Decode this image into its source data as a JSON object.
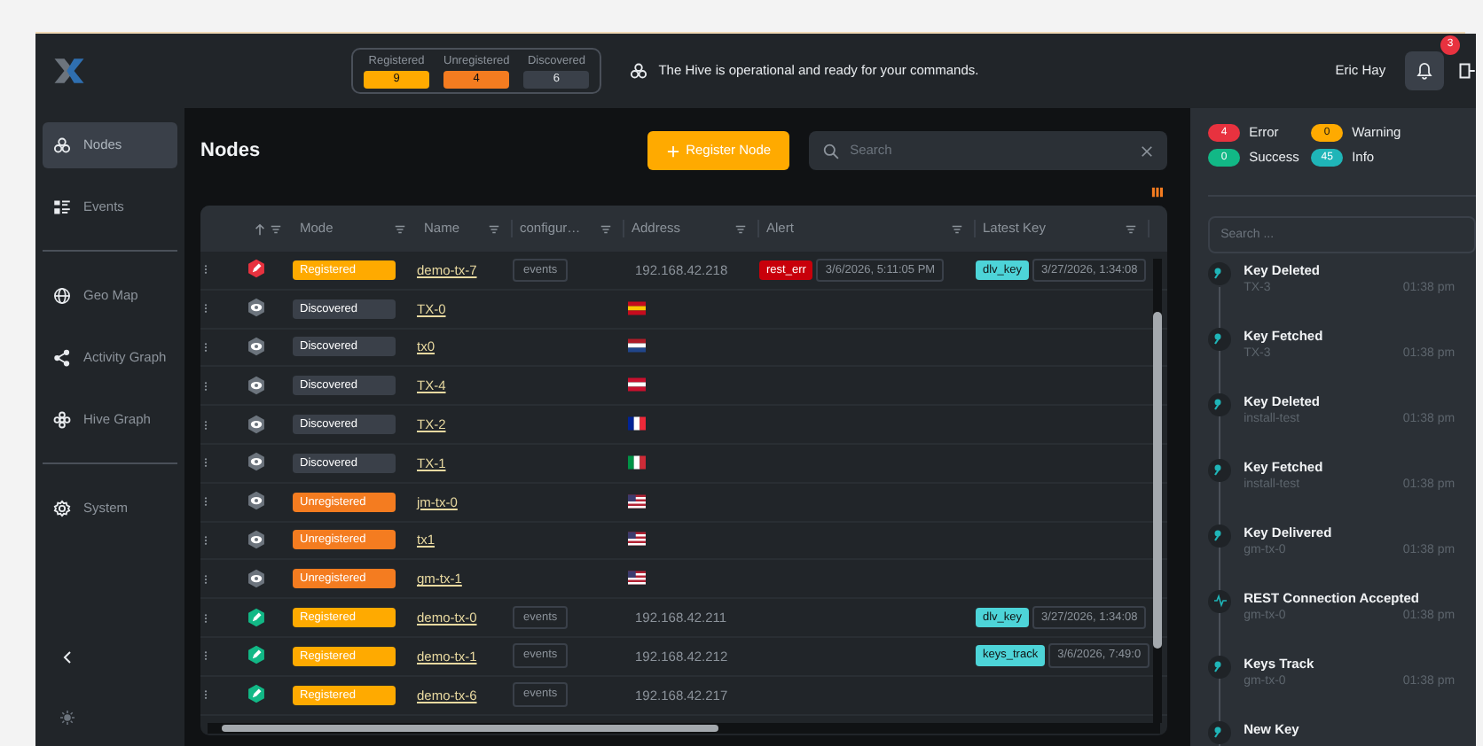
{
  "header": {
    "counters": [
      {
        "label": "Registered",
        "value": "9",
        "color": "#ffaa00"
      },
      {
        "label": "Unregistered",
        "value": "4",
        "color": "#f47c20"
      },
      {
        "label": "Discovered",
        "value": "6",
        "color": "#3a4049"
      }
    ],
    "status_message": "The Hive is operational and ready for your commands.",
    "user": "Eric Hay",
    "notification_count": "3"
  },
  "sidebar": {
    "sections": [
      [
        {
          "label": "Nodes",
          "kind": "hive",
          "selected": true
        },
        {
          "label": "Events",
          "kind": "list",
          "selected": false
        }
      ],
      [
        {
          "label": "Geo Map",
          "kind": "globe",
          "selected": false
        },
        {
          "label": "Activity Graph",
          "kind": "share",
          "selected": false
        },
        {
          "label": "Hive Graph",
          "kind": "flower",
          "selected": false
        }
      ],
      [
        {
          "label": "System",
          "kind": "gear",
          "selected": false
        }
      ]
    ]
  },
  "main": {
    "title": "Nodes",
    "register_button": "Register Node",
    "search": {
      "placeholder": "Search"
    },
    "table": {
      "columns": [
        "Mode",
        "Name",
        "configur…",
        "Address",
        "Alert",
        "Latest Key"
      ],
      "rows": [
        {
          "status_icon": {
            "kind": "pencil",
            "color": "#e8323f"
          },
          "mode": "Registered",
          "kind": "registered",
          "name": "demo-tx-7",
          "config": "events",
          "address": "192.168.42.218",
          "alert": "rest_err",
          "alert_time": "3/6/2026, 5:11:05 PM",
          "latest_key": "dlv_key",
          "key_time": "3/27/2026, 1:34:08"
        },
        {
          "status_icon": {
            "kind": "eye",
            "color": "#6c747d"
          },
          "mode": "Discovered",
          "kind": "discovered",
          "name": "TX-0",
          "flag": {
            "kind": "es"
          }
        },
        {
          "status_icon": {
            "kind": "eye",
            "color": "#6c747d"
          },
          "mode": "Discovered",
          "kind": "discovered",
          "name": "tx0",
          "flag": {
            "kind": "nl"
          }
        },
        {
          "status_icon": {
            "kind": "eye",
            "color": "#6c747d"
          },
          "mode": "Discovered",
          "kind": "discovered",
          "name": "TX-4",
          "flag": {
            "kind": "at"
          }
        },
        {
          "status_icon": {
            "kind": "eye",
            "color": "#6c747d"
          },
          "mode": "Discovered",
          "kind": "discovered",
          "name": "TX-2",
          "flag": {
            "kind": "fr"
          }
        },
        {
          "status_icon": {
            "kind": "eye",
            "color": "#6c747d"
          },
          "mode": "Discovered",
          "kind": "discovered",
          "name": "TX-1",
          "flag": {
            "kind": "it"
          }
        },
        {
          "status_icon": {
            "kind": "eye",
            "color": "#6c747d"
          },
          "mode": "Unregistered",
          "kind": "unregistered",
          "name": "jm-tx-0",
          "flag": {
            "kind": "us"
          }
        },
        {
          "status_icon": {
            "kind": "eye",
            "color": "#6c747d"
          },
          "mode": "Unregistered",
          "kind": "unregistered",
          "name": "tx1",
          "flag": {
            "kind": "us"
          }
        },
        {
          "status_icon": {
            "kind": "eye",
            "color": "#6c747d"
          },
          "mode": "Unregistered",
          "kind": "unregistered",
          "name": "gm-tx-1",
          "flag": {
            "kind": "us"
          }
        },
        {
          "status_icon": {
            "kind": "pencil",
            "color": "#12b886"
          },
          "mode": "Registered",
          "kind": "registered",
          "name": "demo-tx-0",
          "config": "events",
          "address": "192.168.42.211",
          "latest_key": "dlv_key",
          "key_time": "3/27/2026, 1:34:08"
        },
        {
          "status_icon": {
            "kind": "pencil",
            "color": "#12b886"
          },
          "mode": "Registered",
          "kind": "registered",
          "name": "demo-tx-1",
          "config": "events",
          "address": "192.168.42.212",
          "latest_key": "keys_track",
          "key_time": "3/6/2026, 7:49:0"
        },
        {
          "status_icon": {
            "kind": "pencil",
            "color": "#12b886"
          },
          "mode": "Registered",
          "kind": "registered",
          "name": "demo-tx-6",
          "config": "events",
          "address": "192.168.42.217"
        }
      ]
    }
  },
  "event_panel": {
    "legend": [
      {
        "label": "Error",
        "count": "4",
        "color": "#e8323f"
      },
      {
        "label": "Warning",
        "count": "0",
        "color": "#ffaa00"
      },
      {
        "label": "Success",
        "count": "0",
        "color": "#12b886"
      },
      {
        "label": "Info",
        "count": "45",
        "color": "#1fb5b8"
      }
    ],
    "search": {
      "placeholder": "Search ..."
    },
    "events": [
      {
        "kind": "key",
        "title": "Key Deleted",
        "node": "TX-3",
        "time": "01:38 pm"
      },
      {
        "kind": "key",
        "title": "Key Fetched",
        "node": "TX-3",
        "time": "01:38 pm"
      },
      {
        "kind": "key",
        "title": "Key Deleted",
        "node": "install-test",
        "time": "01:38 pm"
      },
      {
        "kind": "key",
        "title": "Key Fetched",
        "node": "install-test",
        "time": "01:38 pm"
      },
      {
        "kind": "key",
        "title": "Key Delivered",
        "node": "gm-tx-0",
        "time": "01:38 pm"
      },
      {
        "kind": "pulse",
        "title": "REST Connection Accepted",
        "node": "gm-tx-0",
        "time": "01:38 pm"
      },
      {
        "kind": "key",
        "title": "Keys Track",
        "node": "gm-tx-0",
        "time": "01:38 pm"
      },
      {
        "kind": "key",
        "title": "New Key"
      }
    ]
  }
}
